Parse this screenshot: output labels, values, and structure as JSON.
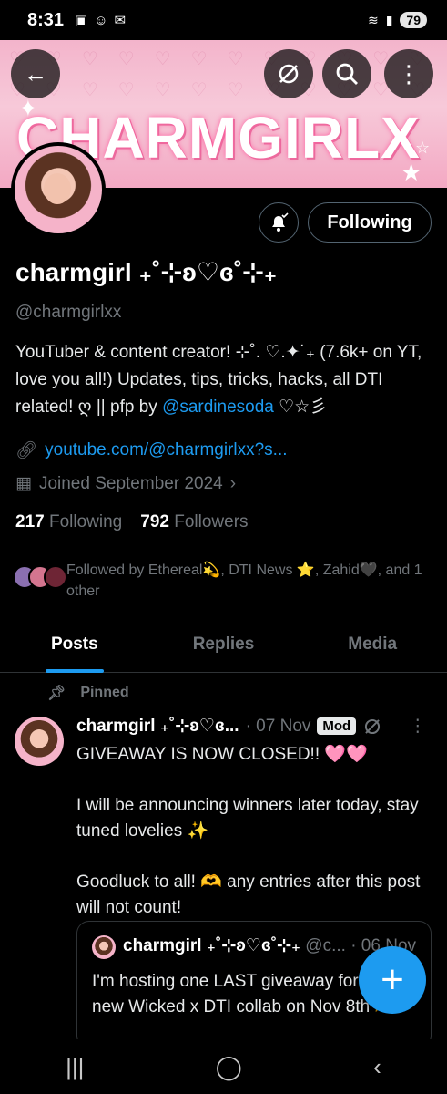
{
  "status_bar": {
    "time": "8:31",
    "battery": "79"
  },
  "banner": {
    "brand_text": "CHARMGIRLX"
  },
  "top_actions": {
    "back": "←",
    "more": "⋮"
  },
  "profile": {
    "display_name": "charmgirl ₊˚⊹ʚ♡ɞ˚⊹₊",
    "handle": "@charmgirlxx",
    "following_button": "Following",
    "bio_text": "YouTuber & content creator! ⊹˚. ♡.✦˙₊ (7.6k+ on YT, love you all!) Updates, tips, tricks, hacks, all DTI related! ღ || pfp by ",
    "bio_mention": "@sardinesoda",
    "bio_tail": " ♡☆彡",
    "link": "youtube.com/@charmgirlxx?s...",
    "joined": "Joined September 2024",
    "following_count": "217",
    "following_label": "Following",
    "followers_count": "792",
    "followers_label": "Followers",
    "followed_by": "Followed by Ethereal💫, DTI News ⭐, Zahid🖤, and 1 other"
  },
  "tabs": [
    "Posts",
    "Replies",
    "Media"
  ],
  "post": {
    "pinned_label": "Pinned",
    "author": "charmgirl ₊˚⊹ʚ♡ɞ...",
    "date": "· 07 Nov",
    "badge": "Mod",
    "line1": "GIVEAWAY IS NOW CLOSED!! 🩷🩷",
    "line2": "I will be announcing winners later today, stay tuned lovelies ✨",
    "line3": "Goodluck to all! 🫶 any entries after this post will not count!",
    "quote": {
      "author": "charmgirl ₊˚⊹ʚ♡ɞ˚⊹₊",
      "handle_date": "@c... · 06 Nov",
      "text": "I'm hosting one LAST giveaway for the new Wicked x DTI collab on Nov 8th 🫶"
    }
  },
  "fab": {
    "label": "+"
  },
  "colors": {
    "accent": "#1d9bf0",
    "background": "#000000",
    "muted": "#71767b"
  }
}
